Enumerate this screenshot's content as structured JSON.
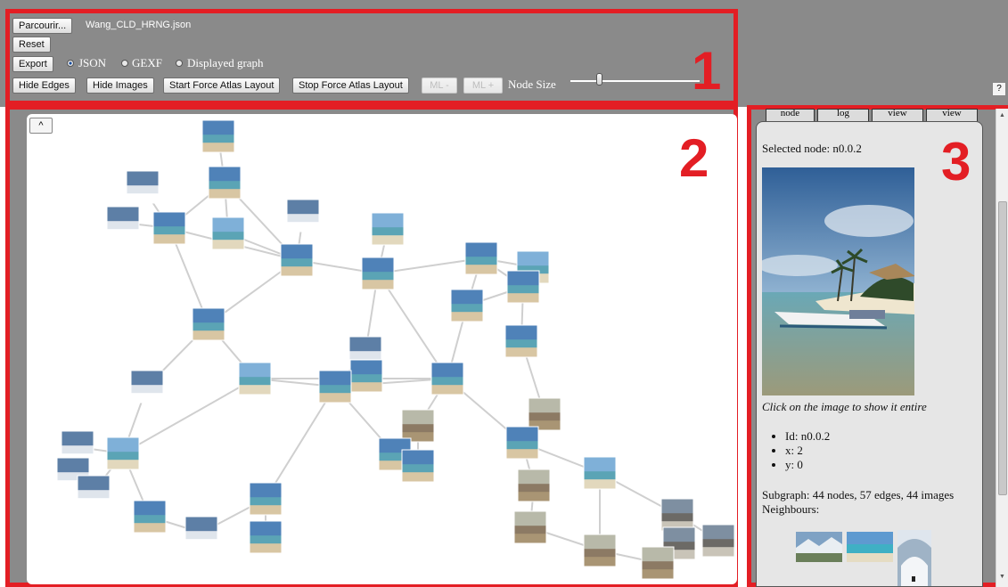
{
  "toolbar": {
    "browse_label": "Parcourir...",
    "file_name": "Wang_CLD_HRNG.json",
    "reset_label": "Reset",
    "export_label": "Export",
    "formats": [
      "JSON",
      "GEXF",
      "Displayed graph"
    ],
    "selected_format": "JSON",
    "hide_edges_label": "Hide Edges",
    "hide_images_label": "Hide Images",
    "start_layout_label": "Start Force Atlas Layout",
    "stop_layout_label": "Stop Force Atlas Layout",
    "ml_minus_label": "ML -",
    "ml_plus_label": "ML +",
    "node_size_label": "Node Size",
    "node_size_level": 0.2,
    "help_label": "?"
  },
  "annotations": {
    "zone1": "1",
    "zone2": "2",
    "zone3": "3"
  },
  "canvas": {
    "collapse_label": "^",
    "colors": {
      "edge": "#cfcfcf",
      "sky": "#4f82b8",
      "sand": "#d8c6a3",
      "sea": "#5ba4b5",
      "elephant": "#8c7a64",
      "rock": "#6c6a66"
    }
  },
  "panel": {
    "tabs": [
      "node",
      "log",
      "view",
      "view"
    ],
    "selected_node_text": "Selected node: n0.0.2",
    "image_caption": "Click on the image to show it entire",
    "properties": [
      "Id: n0.0.2",
      "x: 2",
      "y: 0"
    ],
    "subgraph_text": "Subgraph: 44 nodes, 57 edges, 44 images",
    "neighbours_label": "Neighbours:"
  },
  "colors": {
    "annotation": "#e31e24",
    "toolbar_bg": "#8a8a8a"
  }
}
